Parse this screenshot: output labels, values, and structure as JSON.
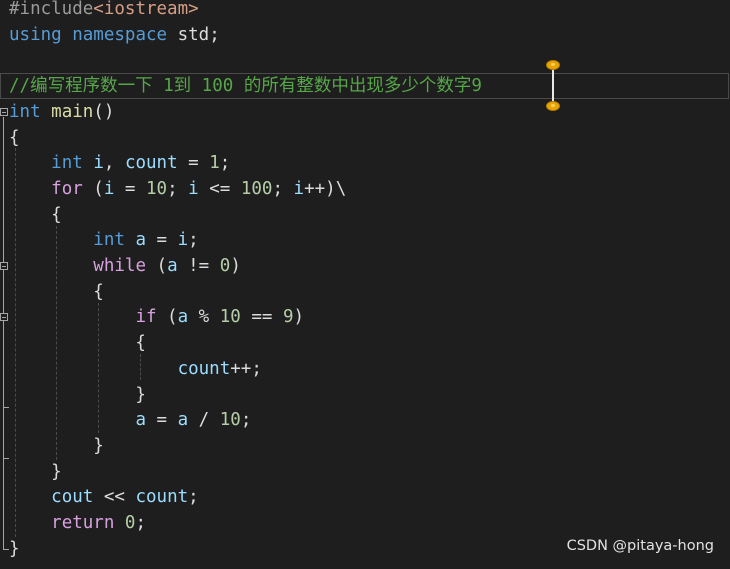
{
  "editor": {
    "lines": [
      [
        {
          "t": "#include",
          "c": "#9b9b9b"
        },
        {
          "t": "<iostream>",
          "c": "#d69d85"
        }
      ],
      [
        {
          "t": "using",
          "c": "#569cd6"
        },
        {
          "t": " ",
          "c": "#dcdcdc"
        },
        {
          "t": "namespace",
          "c": "#569cd6"
        },
        {
          "t": " std;",
          "c": "#dcdcdc"
        }
      ],
      [],
      [
        {
          "t": "//编写程序数一下 1到 100 的所有整数中出现多少个数字9",
          "c": "#57a64a"
        }
      ],
      [
        {
          "t": "int",
          "c": "#569cd6"
        },
        {
          "t": " ",
          "c": "#dcdcdc"
        },
        {
          "t": "main",
          "c": "#dcdcaa"
        },
        {
          "t": "()",
          "c": "#dcdcdc"
        }
      ],
      [
        {
          "t": "{",
          "c": "#dcdcdc"
        }
      ],
      [
        {
          "t": "    ",
          "c": "#dcdcdc"
        },
        {
          "t": "int",
          "c": "#569cd6"
        },
        {
          "t": " ",
          "c": "#dcdcdc"
        },
        {
          "t": "i",
          "c": "#9cdcfe"
        },
        {
          "t": ", ",
          "c": "#dcdcdc"
        },
        {
          "t": "count",
          "c": "#9cdcfe"
        },
        {
          "t": " = ",
          "c": "#dcdcdc"
        },
        {
          "t": "1",
          "c": "#b5cea8"
        },
        {
          "t": ";",
          "c": "#dcdcdc"
        }
      ],
      [
        {
          "t": "    ",
          "c": "#dcdcdc"
        },
        {
          "t": "for",
          "c": "#d8a0df"
        },
        {
          "t": " (",
          "c": "#dcdcdc"
        },
        {
          "t": "i",
          "c": "#9cdcfe"
        },
        {
          "t": " = ",
          "c": "#dcdcdc"
        },
        {
          "t": "10",
          "c": "#b5cea8"
        },
        {
          "t": "; ",
          "c": "#dcdcdc"
        },
        {
          "t": "i",
          "c": "#9cdcfe"
        },
        {
          "t": " <= ",
          "c": "#dcdcdc"
        },
        {
          "t": "100",
          "c": "#b5cea8"
        },
        {
          "t": "; ",
          "c": "#dcdcdc"
        },
        {
          "t": "i",
          "c": "#9cdcfe"
        },
        {
          "t": "++)\\",
          "c": "#dcdcdc"
        }
      ],
      [
        {
          "t": "    {",
          "c": "#dcdcdc"
        }
      ],
      [
        {
          "t": "        ",
          "c": "#dcdcdc"
        },
        {
          "t": "int",
          "c": "#569cd6"
        },
        {
          "t": " ",
          "c": "#dcdcdc"
        },
        {
          "t": "a",
          "c": "#9cdcfe"
        },
        {
          "t": " = ",
          "c": "#dcdcdc"
        },
        {
          "t": "i",
          "c": "#9cdcfe"
        },
        {
          "t": ";",
          "c": "#dcdcdc"
        }
      ],
      [
        {
          "t": "        ",
          "c": "#dcdcdc"
        },
        {
          "t": "while",
          "c": "#d8a0df"
        },
        {
          "t": " (",
          "c": "#dcdcdc"
        },
        {
          "t": "a",
          "c": "#9cdcfe"
        },
        {
          "t": " != ",
          "c": "#dcdcdc"
        },
        {
          "t": "0",
          "c": "#b5cea8"
        },
        {
          "t": ")",
          "c": "#dcdcdc"
        }
      ],
      [
        {
          "t": "        {",
          "c": "#dcdcdc"
        }
      ],
      [
        {
          "t": "            ",
          "c": "#dcdcdc"
        },
        {
          "t": "if",
          "c": "#d8a0df"
        },
        {
          "t": " (",
          "c": "#dcdcdc"
        },
        {
          "t": "a",
          "c": "#9cdcfe"
        },
        {
          "t": " % ",
          "c": "#dcdcdc"
        },
        {
          "t": "10",
          "c": "#b5cea8"
        },
        {
          "t": " == ",
          "c": "#dcdcdc"
        },
        {
          "t": "9",
          "c": "#b5cea8"
        },
        {
          "t": ")",
          "c": "#dcdcdc"
        }
      ],
      [
        {
          "t": "            {",
          "c": "#dcdcdc"
        }
      ],
      [
        {
          "t": "                ",
          "c": "#dcdcdc"
        },
        {
          "t": "count",
          "c": "#9cdcfe"
        },
        {
          "t": "++;",
          "c": "#dcdcdc"
        }
      ],
      [
        {
          "t": "            }",
          "c": "#dcdcdc"
        }
      ],
      [
        {
          "t": "            ",
          "c": "#dcdcdc"
        },
        {
          "t": "a",
          "c": "#9cdcfe"
        },
        {
          "t": " = ",
          "c": "#dcdcdc"
        },
        {
          "t": "a",
          "c": "#9cdcfe"
        },
        {
          "t": " / ",
          "c": "#dcdcdc"
        },
        {
          "t": "10",
          "c": "#b5cea8"
        },
        {
          "t": ";",
          "c": "#dcdcdc"
        }
      ],
      [
        {
          "t": "        }",
          "c": "#dcdcdc"
        }
      ],
      [
        {
          "t": "    }",
          "c": "#dcdcdc"
        }
      ],
      [
        {
          "t": "    ",
          "c": "#dcdcdc"
        },
        {
          "t": "cout",
          "c": "#9cdcfe"
        },
        {
          "t": " << ",
          "c": "#dcdcdc"
        },
        {
          "t": "count",
          "c": "#9cdcfe"
        },
        {
          "t": ";",
          "c": "#dcdcdc"
        }
      ],
      [
        {
          "t": "    ",
          "c": "#dcdcdc"
        },
        {
          "t": "return",
          "c": "#d8a0df"
        },
        {
          "t": " ",
          "c": "#dcdcdc"
        },
        {
          "t": "0",
          "c": "#b5cea8"
        },
        {
          "t": ";",
          "c": "#dcdcdc"
        }
      ],
      [
        {
          "t": "}",
          "c": "#dcdcdc"
        }
      ]
    ],
    "colors": {
      "background": "#1e1e1e",
      "comment": "#57a64a",
      "keyword": "#569cd6",
      "control_keyword": "#d8a0df",
      "function": "#dcdcaa",
      "variable": "#9cdcfe",
      "number": "#b5cea8",
      "include_path": "#d69d85",
      "text": "#dcdcdc",
      "caret_handle": "#e8a400"
    },
    "fold_markers": [
      "main",
      "while",
      "if"
    ]
  },
  "watermark": {
    "text": "CSDN @pitaya-hong"
  }
}
